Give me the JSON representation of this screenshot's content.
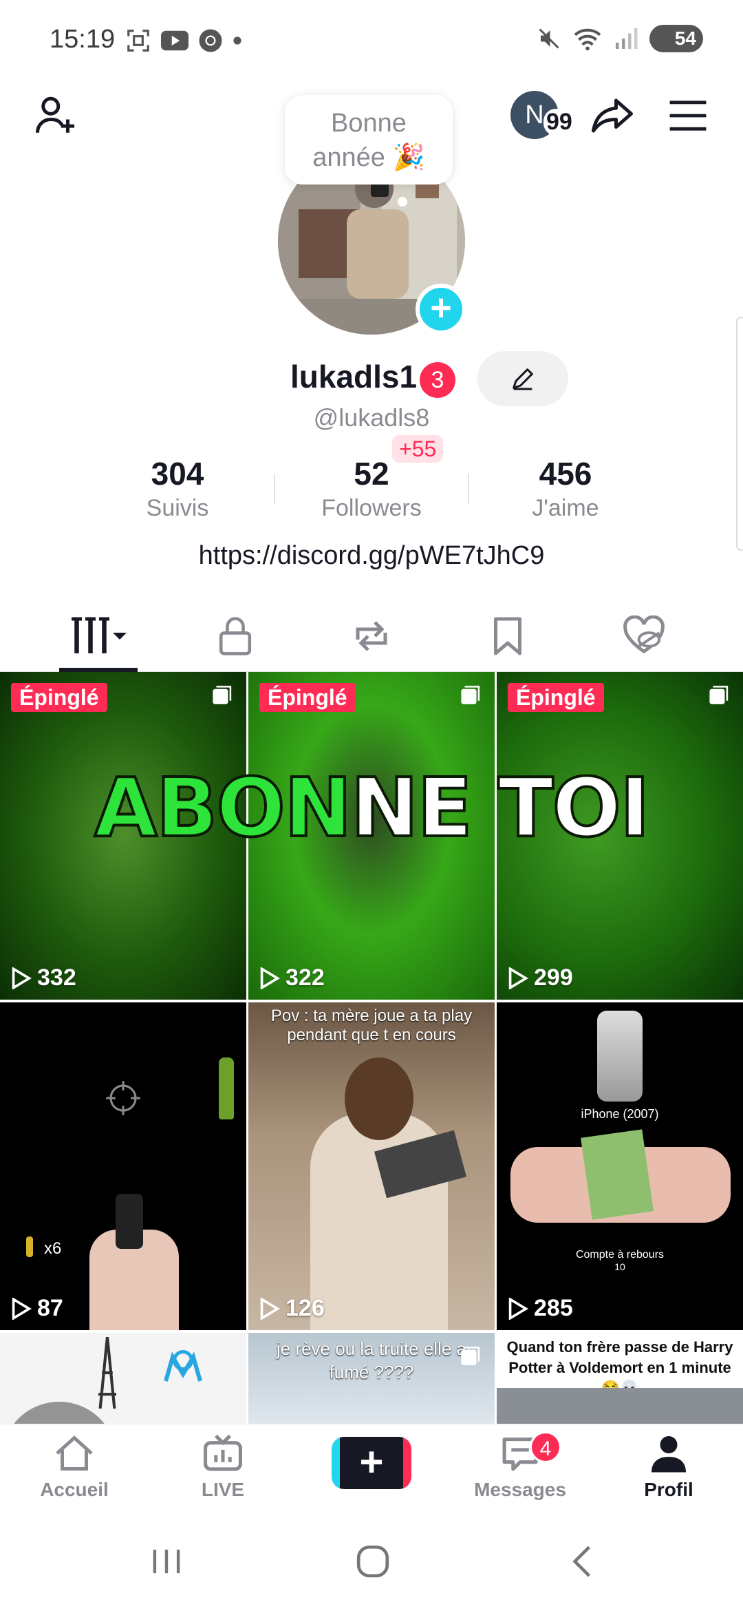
{
  "status_bar": {
    "time": "15:19",
    "battery": "54",
    "left_icons": [
      "screenshot-icon",
      "youtube-icon",
      "chrome-icon",
      "dot-icon"
    ],
    "right_icons": [
      "mute-icon",
      "wifi-icon",
      "signal-icon",
      "battery-icon"
    ]
  },
  "header": {
    "notification_avatar_letter": "N",
    "notification_count": "99"
  },
  "note": {
    "line1": "Bonne",
    "line2": "année 🎉"
  },
  "profile": {
    "display_name": "lukadls1",
    "name_badge": "3",
    "handle": "@lukadls8",
    "new_followers": "+55",
    "bio_link": "https://discord.gg/pWE7tJhC9"
  },
  "stats": [
    {
      "value": "304",
      "label": "Suivis"
    },
    {
      "value": "52",
      "label": "Followers"
    },
    {
      "value": "456",
      "label": "J'aime"
    }
  ],
  "tabs": [
    "videos-grid-icon",
    "lock-icon",
    "repost-icon",
    "bookmark-icon",
    "liked-icon"
  ],
  "pinned": {
    "badge": "Épinglé",
    "banner_text_green": "ABONNE",
    "banner_text_white": "TOI",
    "banner_green": "ABON",
    "banner_white_part": "NE TOI"
  },
  "videos": [
    {
      "views": "332",
      "pinned": true
    },
    {
      "views": "322",
      "pinned": true
    },
    {
      "views": "299",
      "pinned": true
    },
    {
      "views": "87",
      "extra": "x6"
    },
    {
      "views": "126",
      "caption": "Pov : ta mère joue a ta play pendant que t en cours"
    },
    {
      "views": "285",
      "caption_top": "iPhone (2007)",
      "caption_bottom": "Compte à rebours",
      "caption_num": "10"
    },
    {
      "caption": ""
    },
    {
      "caption": "je rève ou la truite elle a fumé ????"
    },
    {
      "caption": "Quand ton frère passe de Harry Potter à Voldemort en 1 minute 😂💀"
    }
  ],
  "bottom_nav": [
    {
      "label": "Accueil"
    },
    {
      "label": "LIVE"
    },
    {
      "label": ""
    },
    {
      "label": "Messages",
      "badge": "4"
    },
    {
      "label": "Profil"
    }
  ],
  "colors": {
    "accent_red": "#fe2c55",
    "accent_cyan": "#20d5ec",
    "text": "#161823",
    "muted": "#8a8b91",
    "green": "#2ee33a"
  }
}
